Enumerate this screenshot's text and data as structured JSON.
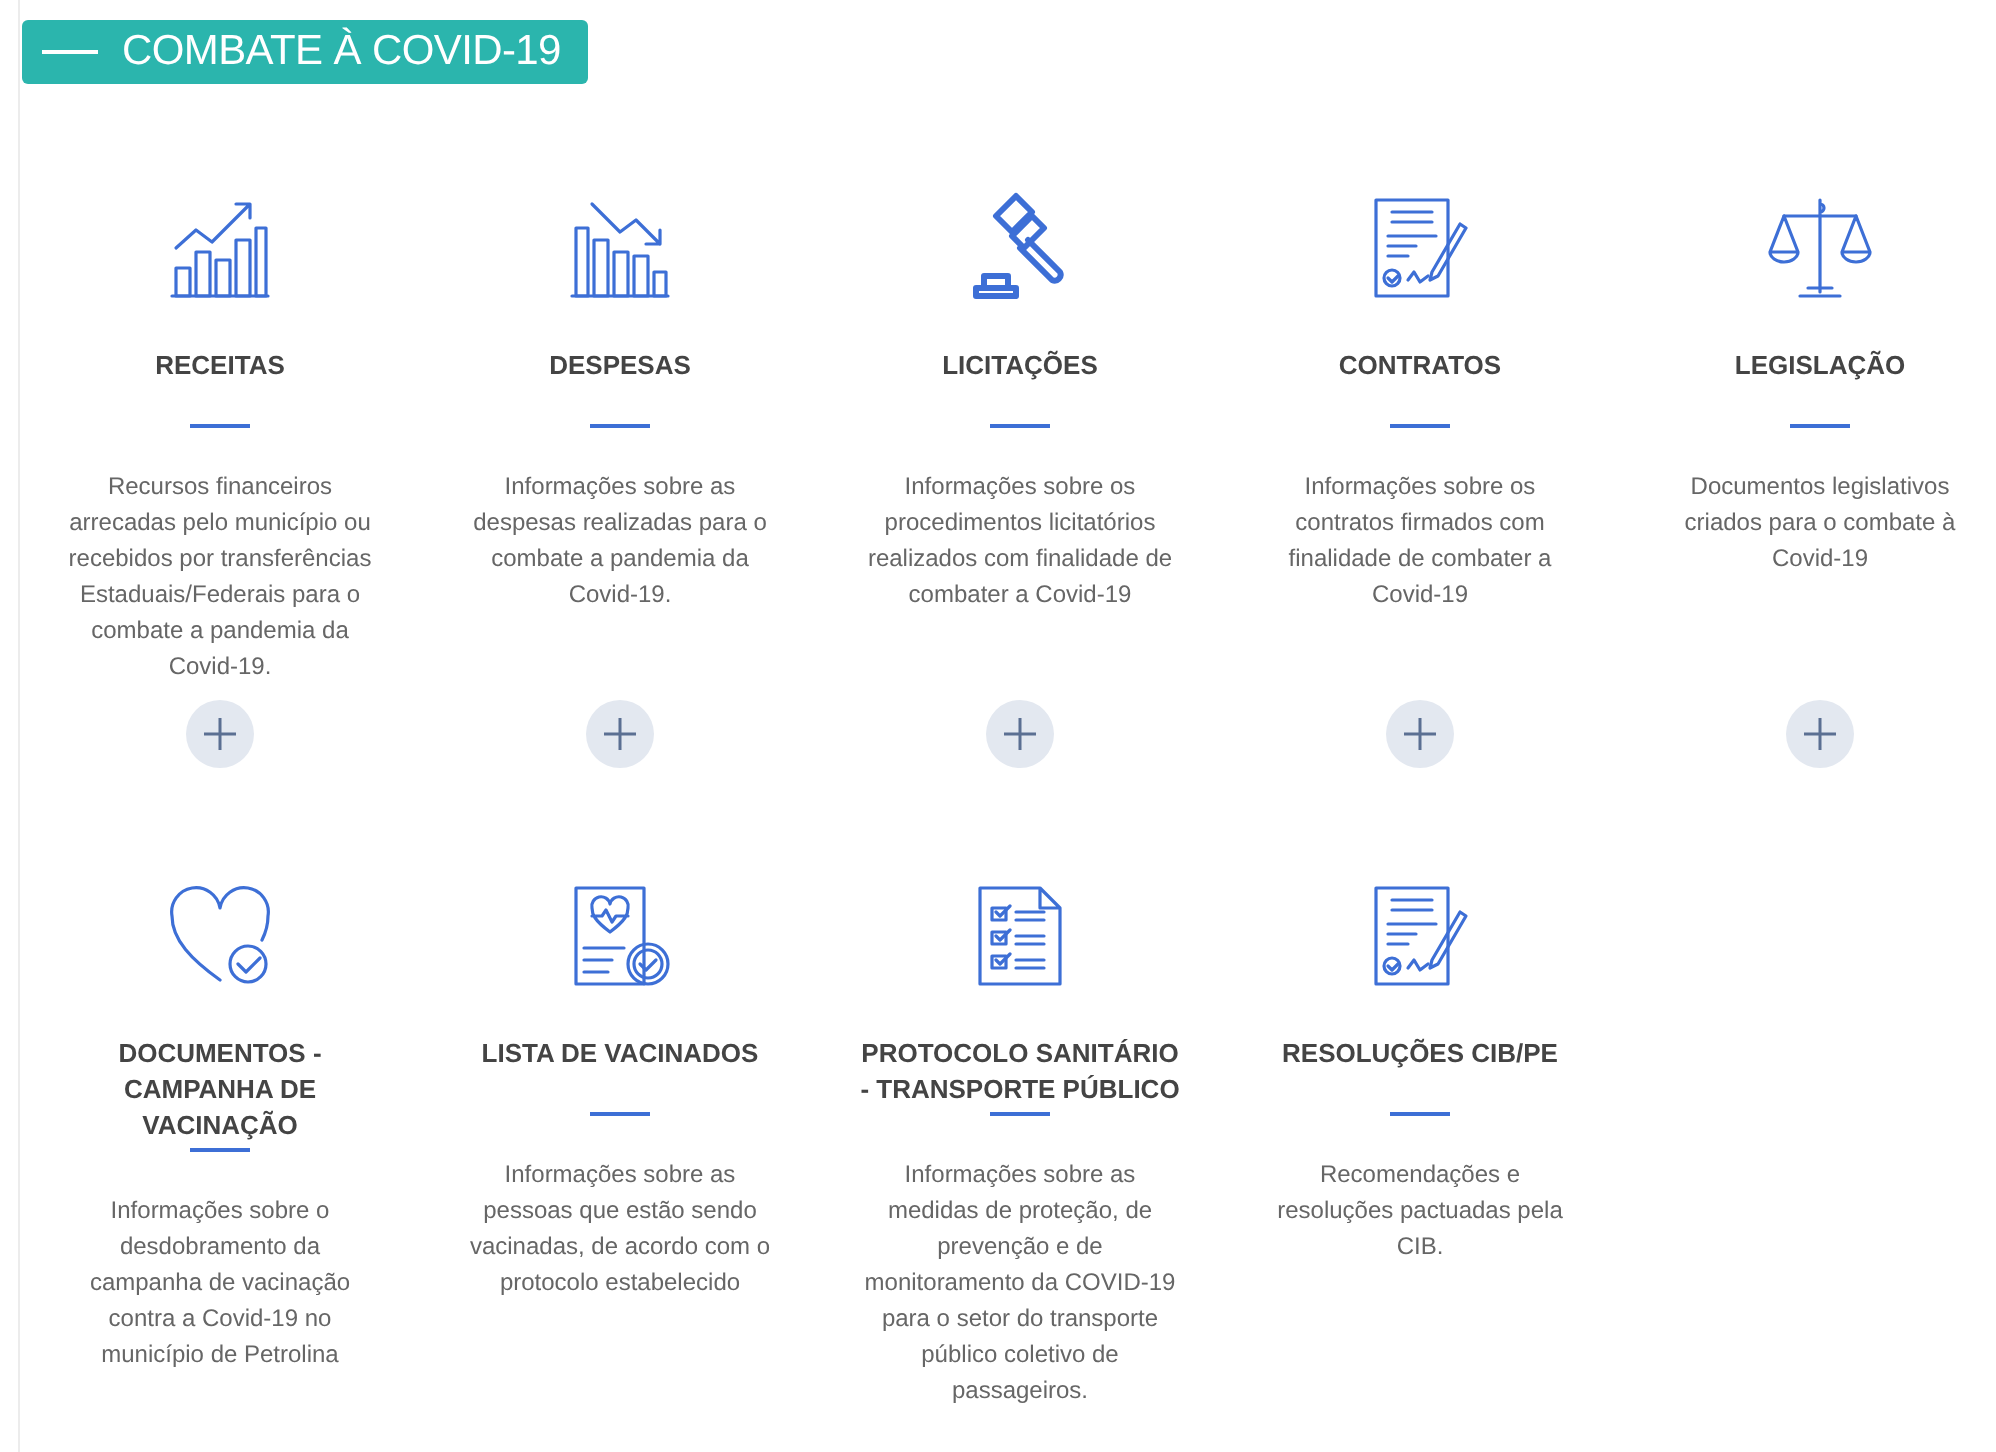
{
  "header": {
    "title": "COMBATE À COVID-19"
  },
  "cards": [
    {
      "kind": "growth",
      "title": "RECEITAS",
      "description": "Recursos financeiros arrecadas pelo município ou recebidos por transferências Estaduais/Federais para o combate a pandemia da Covid-19.",
      "expand_button": true
    },
    {
      "kind": "decline",
      "title": "DESPESAS",
      "description": "Informações sobre as despesas realizadas para o combate a pandemia da Covid-19.",
      "expand_button": true
    },
    {
      "kind": "gavel",
      "title": "LICITAÇÕES",
      "description": "Informações sobre os procedimentos licitatórios realizados com finalidade de combater a Covid-19",
      "expand_button": true
    },
    {
      "kind": "contract",
      "title": "CONTRATOS",
      "description": "Informações sobre os contratos firmados com finalidade de combater a Covid-19",
      "expand_button": true
    },
    {
      "kind": "scale",
      "title": "LEGISLAÇÃO",
      "description": "Documentos legislativos criados para o combate à Covid-19",
      "expand_button": true
    },
    {
      "kind": "heart",
      "title": "DOCUMENTOS - CAMPANHA DE VACINAÇÃO",
      "description": "Informações sobre o desdobramento da campanha de vacinação contra a Covid-19 no município de Petrolina",
      "expand_button": false
    },
    {
      "kind": "certificate",
      "title": "LISTA DE VACINADOS",
      "description": "Informações sobre as pessoas que estão sendo vacinadas, de acordo com o protocolo estabelecido",
      "expand_button": false
    },
    {
      "kind": "checklist",
      "title": "PROTOCOLO SANITÁRIO - TRANSPORTE PÚBLICO",
      "description": "Informações sobre as medidas de proteção, de prevenção e de monitoramento da COVID-19 para o setor do transporte público coletivo de passageiros.",
      "expand_button": false
    },
    {
      "kind": "contract",
      "title": "RESOLUÇÕES CIB/PE",
      "description": "Recomendações e resoluções pactuadas pela CIB.",
      "expand_button": false
    }
  ]
}
